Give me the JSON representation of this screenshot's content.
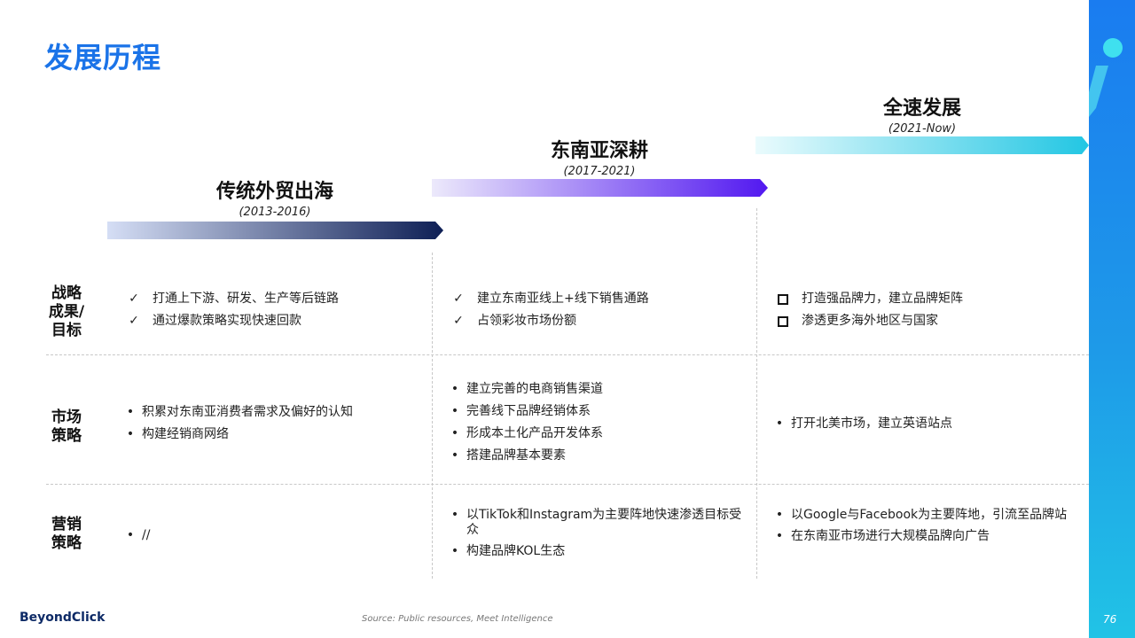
{
  "title": "发展历程",
  "phases": [
    {
      "name": "传统外贸出海",
      "years": "(2013-2016)"
    },
    {
      "name": "东南亚深耕",
      "years": "(2017-2021)"
    },
    {
      "name": "全速发展",
      "years": "(2021-Now)"
    }
  ],
  "rows": {
    "strategy": {
      "label": [
        "战略",
        "成果/",
        "目标"
      ],
      "cells": [
        [
          "打通上下游、研发、生产等后链路",
          "通过爆款策略实现快速回款"
        ],
        [
          "建立东南亚线上+线下销售通路",
          "占领彩妆市场份额"
        ],
        [
          "打造强品牌力，建立品牌矩阵",
          "渗透更多海外地区与国家"
        ]
      ]
    },
    "market": {
      "label": [
        "市场",
        "策略"
      ],
      "cells": [
        [
          "积累对东南亚消费者需求及偏好的认知",
          "构建经销商网络"
        ],
        [
          "建立完善的电商销售渠道",
          "完善线下品牌经销体系",
          "形成本土化产品开发体系",
          "搭建品牌基本要素"
        ],
        [
          "打开北美市场，建立英语站点"
        ]
      ]
    },
    "marketing": {
      "label": [
        "营销",
        "策略"
      ],
      "cells": [
        [
          "//"
        ],
        [
          "以TikTok和Instagram为主要阵地快速渗透目标受众",
          "构建品牌KOL生态"
        ],
        [
          "以Google与Facebook为主要阵地，引流至品牌站",
          "在东南亚市场进行大规模品牌向广告"
        ]
      ]
    }
  },
  "markers": {
    "check": "✓",
    "bullet": "•"
  },
  "footer": {
    "logo": "BeyondClick",
    "source": "Source: Public resources, Meet Intelligence",
    "page": "76"
  },
  "colors": {
    "title": "#1a73e8",
    "sidebar": "#1a7cf0"
  }
}
